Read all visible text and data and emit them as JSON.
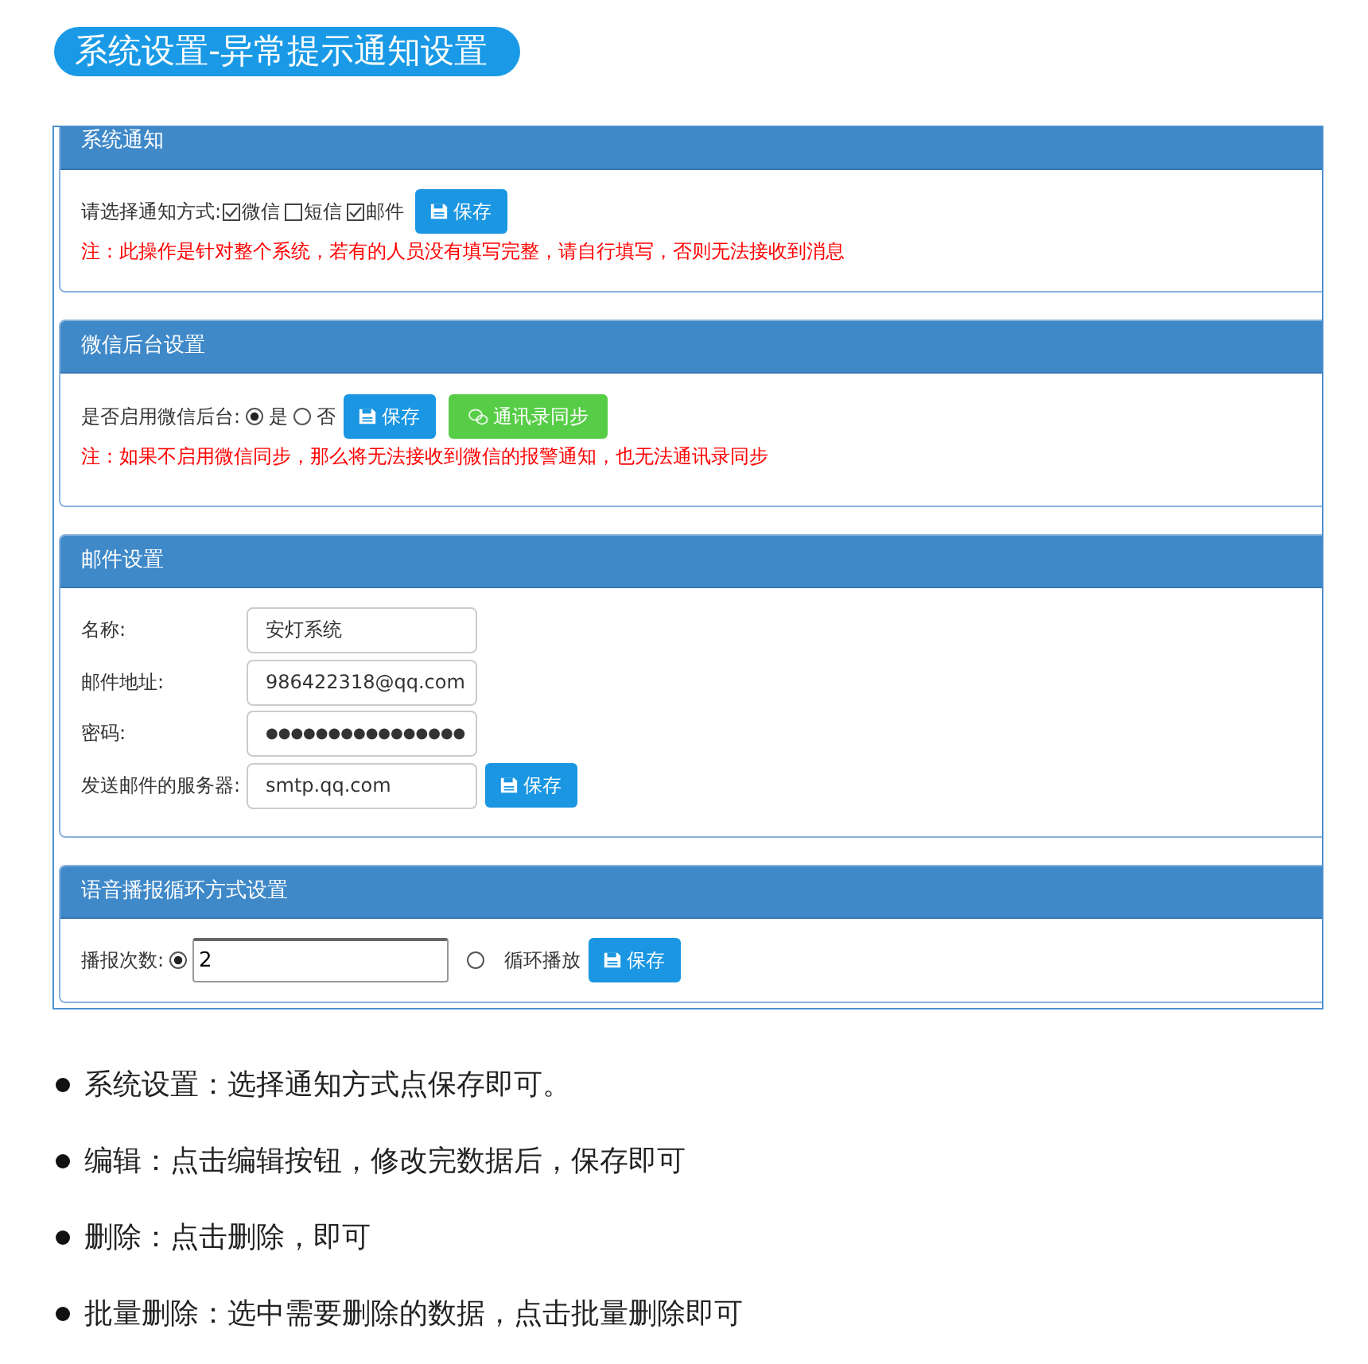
{
  "title": "系统设置-异常提示通知设置",
  "sections": [
    {
      "kind": "notify",
      "title": "系统通知",
      "label": "请选择通知方式:",
      "options": [
        {
          "label": "微信",
          "checked": true
        },
        {
          "label": "短信",
          "checked": false
        },
        {
          "label": "邮件",
          "checked": true
        }
      ],
      "buttons": [
        {
          "kind": "save",
          "label": "保存"
        }
      ],
      "note": "注：此操作是针对整个系统，若有的人员没有填写完整，请自行填写，否则无法接收到消息"
    },
    {
      "kind": "wechat",
      "title": "微信后台设置",
      "label": "是否启用微信后台:",
      "options": [
        {
          "label": "是",
          "selected": true
        },
        {
          "label": "否",
          "selected": false
        }
      ],
      "buttons": [
        {
          "kind": "save",
          "label": "保存"
        },
        {
          "kind": "sync",
          "label": "通讯录同步"
        }
      ],
      "note": "注：如果不启用微信同步，那么将无法接收到微信的报警通知，也无法通讯录同步"
    },
    {
      "kind": "mail",
      "title": "邮件设置",
      "fields": [
        {
          "label": "名称:",
          "value": "安灯系统"
        },
        {
          "label": "邮件地址:",
          "value": "986422318@qq.com"
        },
        {
          "label": "密码:",
          "value": "●●●●●●●●●●●●●●●●"
        },
        {
          "label": "发送邮件的服务器:",
          "value": "smtp.qq.com"
        }
      ],
      "buttons": [
        {
          "kind": "save",
          "label": "保存"
        }
      ]
    },
    {
      "kind": "voice",
      "title": "语音播报循环方式设置",
      "label": "播报次数:",
      "options": [
        {
          "selected": true,
          "value": "2"
        },
        {
          "selected": false,
          "label": "循环播放"
        }
      ],
      "buttons": [
        {
          "kind": "save",
          "label": "保存"
        }
      ]
    }
  ],
  "notes": [
    "系统设置：选择通知方式点保存即可。",
    "编辑：点击编辑按钮，修改完数据后，保存即可",
    "删除：点击删除，即可",
    "批量删除：选中需要删除的数据，点击批量删除即可"
  ]
}
